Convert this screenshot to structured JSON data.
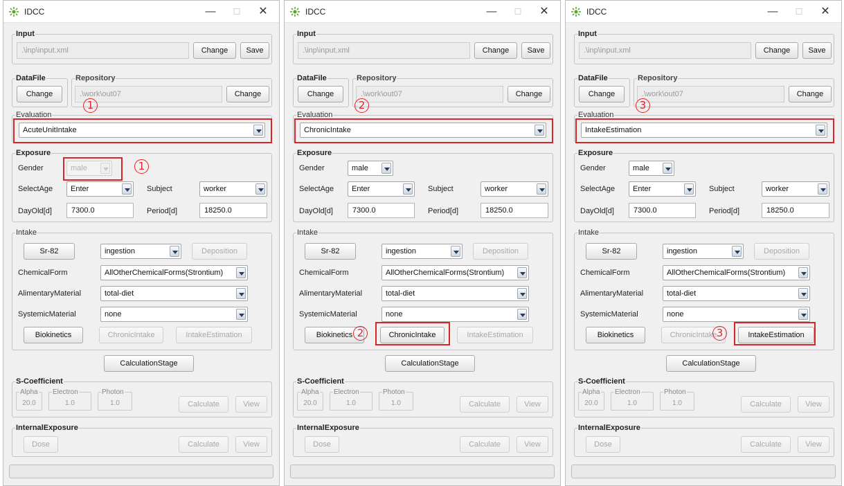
{
  "windows": [
    {
      "title": "IDCC",
      "annotation": "1",
      "input": {
        "label": "Input",
        "path": ".\\inp\\input.xml",
        "change": "Change",
        "save": "Save"
      },
      "datafile": {
        "label": "DataFile",
        "change": "Change"
      },
      "repository": {
        "label": "Repository",
        "path": ".\\work\\out07",
        "change": "Change"
      },
      "evaluation": {
        "label": "Evaluation",
        "value": "AcuteUnitIntake"
      },
      "exposure": {
        "label": "Exposure",
        "gender_label": "Gender",
        "gender_value": "male",
        "selectage_label": "SelectAge",
        "selectage_value": "Enter",
        "subject_label": "Subject",
        "subject_value": "worker",
        "dayold_label": "DayOld[d]",
        "dayold_value": "7300.0",
        "period_label": "Period[d]",
        "period_value": "18250.0"
      },
      "intake": {
        "label": "Intake",
        "nuclide": "Sr-82",
        "route": "ingestion",
        "deposition": "Deposition",
        "chemform_label": "ChemicalForm",
        "chemform_value": "AllOtherChemicalForms(Strontium)",
        "alim_label": "AlimentaryMaterial",
        "alim_value": "total-diet",
        "syst_label": "SystemicMaterial",
        "syst_value": "none",
        "biokinetics": "Biokinetics",
        "chronic": "ChronicIntake",
        "estimation": "IntakeEstimation"
      },
      "calc_stage": "CalculationStage",
      "scoef": {
        "label": "S-Coefficient",
        "alpha_label": "Alpha",
        "alpha_value": "20.0",
        "electron_label": "Electron",
        "electron_value": "1.0",
        "photon_label": "Photon",
        "photon_value": "1.0",
        "calculate": "Calculate",
        "view": "View"
      },
      "internal": {
        "label": "InternalExposure",
        "dose": "Dose",
        "calculate": "Calculate",
        "view": "View"
      }
    },
    {
      "title": "IDCC",
      "annotation": "2",
      "input": {
        "label": "Input",
        "path": ".\\inp\\input.xml",
        "change": "Change",
        "save": "Save"
      },
      "datafile": {
        "label": "DataFile",
        "change": "Change"
      },
      "repository": {
        "label": "Repository",
        "path": ".\\work\\out07",
        "change": "Change"
      },
      "evaluation": {
        "label": "Evaluation",
        "value": "ChronicIntake"
      },
      "exposure": {
        "label": "Exposure",
        "gender_label": "Gender",
        "gender_value": "male",
        "selectage_label": "SelectAge",
        "selectage_value": "Enter",
        "subject_label": "Subject",
        "subject_value": "worker",
        "dayold_label": "DayOld[d]",
        "dayold_value": "7300.0",
        "period_label": "Period[d]",
        "period_value": "18250.0"
      },
      "intake": {
        "label": "Intake",
        "nuclide": "Sr-82",
        "route": "ingestion",
        "deposition": "Deposition",
        "chemform_label": "ChemicalForm",
        "chemform_value": "AllOtherChemicalForms(Strontium)",
        "alim_label": "AlimentaryMaterial",
        "alim_value": "total-diet",
        "syst_label": "SystemicMaterial",
        "syst_value": "none",
        "biokinetics": "Biokinetics",
        "chronic": "ChronicIntake",
        "estimation": "IntakeEstimation"
      },
      "calc_stage": "CalculationStage",
      "scoef": {
        "label": "S-Coefficient",
        "alpha_label": "Alpha",
        "alpha_value": "20.0",
        "electron_label": "Electron",
        "electron_value": "1.0",
        "photon_label": "Photon",
        "photon_value": "1.0",
        "calculate": "Calculate",
        "view": "View"
      },
      "internal": {
        "label": "InternalExposure",
        "dose": "Dose",
        "calculate": "Calculate",
        "view": "View"
      }
    },
    {
      "title": "IDCC",
      "annotation": "3",
      "input": {
        "label": "Input",
        "path": ".\\inp\\input.xml",
        "change": "Change",
        "save": "Save"
      },
      "datafile": {
        "label": "DataFile",
        "change": "Change"
      },
      "repository": {
        "label": "Repository",
        "path": ".\\work\\out07",
        "change": "Change"
      },
      "evaluation": {
        "label": "Evaluation",
        "value": "IntakeEstimation"
      },
      "exposure": {
        "label": "Exposure",
        "gender_label": "Gender",
        "gender_value": "male",
        "selectage_label": "SelectAge",
        "selectage_value": "Enter",
        "subject_label": "Subject",
        "subject_value": "worker",
        "dayold_label": "DayOld[d]",
        "dayold_value": "7300.0",
        "period_label": "Period[d]",
        "period_value": "18250.0"
      },
      "intake": {
        "label": "Intake",
        "nuclide": "Sr-82",
        "route": "ingestion",
        "deposition": "Deposition",
        "chemform_label": "ChemicalForm",
        "chemform_value": "AllOtherChemicalForms(Strontium)",
        "alim_label": "AlimentaryMaterial",
        "alim_value": "total-diet",
        "syst_label": "SystemicMaterial",
        "syst_value": "none",
        "biokinetics": "Biokinetics",
        "chronic": "ChronicIntake",
        "estimation": "IntakeEstimation"
      },
      "calc_stage": "CalculationStage",
      "scoef": {
        "label": "S-Coefficient",
        "alpha_label": "Alpha",
        "alpha_value": "20.0",
        "electron_label": "Electron",
        "electron_value": "1.0",
        "photon_label": "Photon",
        "photon_value": "1.0",
        "calculate": "Calculate",
        "view": "View"
      },
      "internal": {
        "label": "InternalExposure",
        "dose": "Dose",
        "calculate": "Calculate",
        "view": "View"
      }
    }
  ],
  "window_buttons": {
    "minimize": "—",
    "maximize": "☐",
    "close": "✕"
  },
  "colors": {
    "highlight": "#d9252a",
    "app_icon": "#5aa832"
  }
}
